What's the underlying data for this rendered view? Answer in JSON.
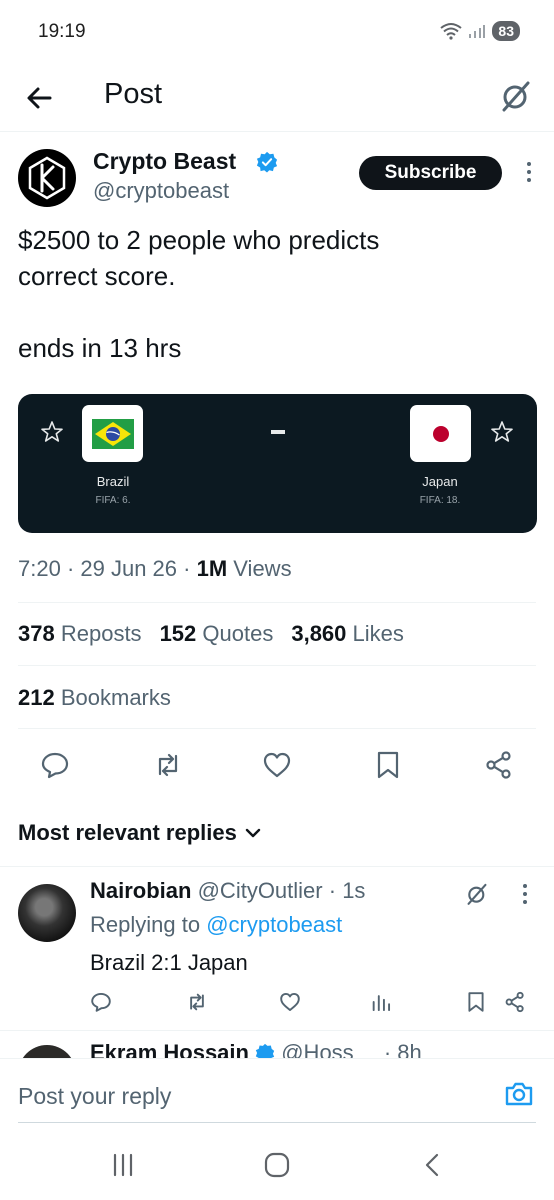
{
  "status": {
    "time": "19:19",
    "battery": "83"
  },
  "header": {
    "title": "Post"
  },
  "post": {
    "author_name": "Crypto Beast",
    "author_handle": "@cryptobeast",
    "subscribe_label": "Subscribe",
    "text": "$2500 to 2 people who predicts\ncorrect score.\n\nends in 13 hrs",
    "match": {
      "home": {
        "name": "Brazil",
        "fifa": "FIFA: 6."
      },
      "away": {
        "name": "Japan",
        "fifa": "FIFA: 18."
      },
      "separator": "-"
    },
    "time": "7:20",
    "date": "29 Jun 26",
    "views_count": "1M",
    "views_label": "Views",
    "reposts_count": "378",
    "reposts_label": "Reposts",
    "quotes_count": "152",
    "quotes_label": "Quotes",
    "likes_count": "3,860",
    "likes_label": "Likes",
    "bookmarks_count": "212",
    "bookmarks_label": "Bookmarks"
  },
  "replies": {
    "sort_label": "Most relevant replies",
    "items": [
      {
        "name": "Nairobian",
        "handle": "@CityOutlier",
        "time": "· 1s",
        "replying_prefix": "Replying to",
        "replying_to": "@cryptobeast",
        "text": "Brazil 2:1 Japan"
      },
      {
        "name": "Ekram Hossain",
        "handle": "@Hoss",
        "time": "· 8h"
      }
    ]
  },
  "composer": {
    "placeholder": "Post your reply"
  },
  "colors": {
    "accent": "#1d9bf0",
    "text": "#0f1419",
    "muted": "#536471",
    "card": "#0c1921"
  }
}
